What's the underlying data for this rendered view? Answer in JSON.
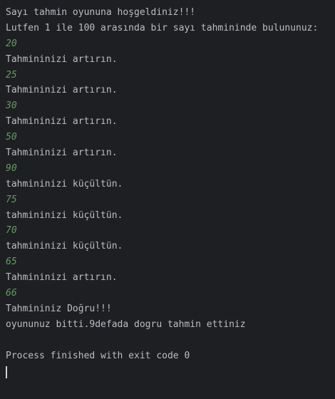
{
  "console": {
    "lines": [
      {
        "kind": "output",
        "text": "Sayı tahmin oyununa hoşgeldiniz!!!"
      },
      {
        "kind": "output",
        "text": "Lutfen 1 ile 100 arasında bir sayı tahmininde bulununuz:"
      },
      {
        "kind": "input",
        "text": "20"
      },
      {
        "kind": "output",
        "text": "Tahmininizi artırın."
      },
      {
        "kind": "input",
        "text": "25"
      },
      {
        "kind": "output",
        "text": "Tahmininizi artırın."
      },
      {
        "kind": "input",
        "text": "30"
      },
      {
        "kind": "output",
        "text": "Tahmininizi artırın."
      },
      {
        "kind": "input",
        "text": "50"
      },
      {
        "kind": "output",
        "text": "Tahmininizi artırın."
      },
      {
        "kind": "input",
        "text": "90"
      },
      {
        "kind": "output",
        "text": "tahmininizi küçültün."
      },
      {
        "kind": "input",
        "text": "75"
      },
      {
        "kind": "output",
        "text": "tahmininizi küçültün."
      },
      {
        "kind": "input",
        "text": "70"
      },
      {
        "kind": "output",
        "text": "tahmininizi küçültün."
      },
      {
        "kind": "input",
        "text": "65"
      },
      {
        "kind": "output",
        "text": "Tahmininizi artırın."
      },
      {
        "kind": "input",
        "text": "66"
      },
      {
        "kind": "output",
        "text": "Tahmininiz Doğru!!!"
      },
      {
        "kind": "output",
        "text": "oyununuz bitti.9defada dogru tahmin ettiniz"
      },
      {
        "kind": "blank",
        "text": ""
      },
      {
        "kind": "output",
        "text": "Process finished with exit code 0"
      }
    ]
  },
  "colors": {
    "background": "#1e1f22",
    "output_text": "#bcbec4",
    "input_text": "#5f9c62"
  }
}
